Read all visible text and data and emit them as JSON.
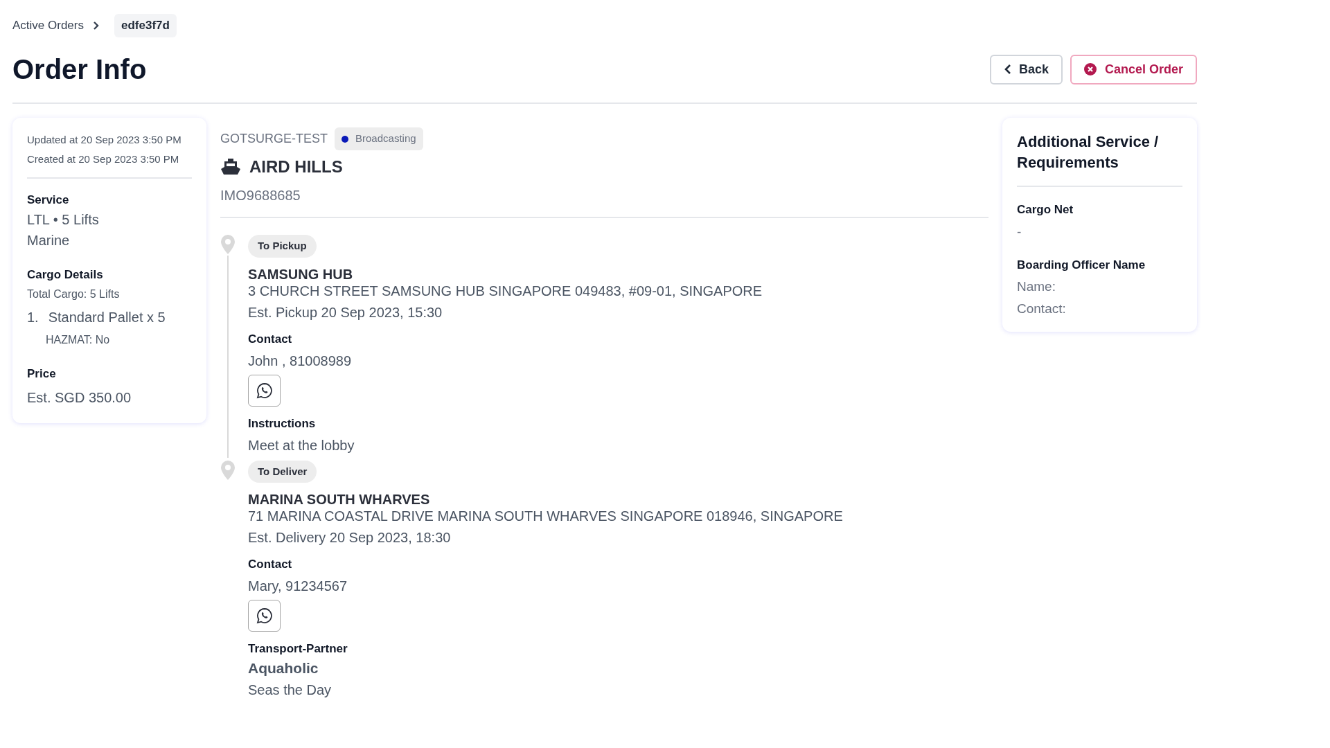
{
  "breadcrumb": {
    "parent": "Active Orders",
    "current": "edfe3f7d"
  },
  "title": "Order Info",
  "actions": {
    "back": "Back",
    "cancel": "Cancel Order"
  },
  "summary": {
    "updated": "Updated at 20 Sep 2023 3:50 PM",
    "created": "Created at 20 Sep 2023 3:50 PM",
    "service": {
      "label": "Service",
      "lines": [
        "LTL • 5 Lifts",
        "Marine"
      ]
    },
    "cargo": {
      "label": "Cargo Details",
      "total": "Total Cargo: 5 Lifts",
      "items": [
        {
          "number": "1.",
          "name": "Standard Pallet x 5",
          "hazmat": "HAZMAT: No"
        }
      ]
    },
    "price": {
      "label": "Price",
      "value": "Est. SGD 350.00"
    }
  },
  "vessel": {
    "company": "GOTSURGE-TEST",
    "status": {
      "label": "Broadcasting",
      "color": "#0a1ab8"
    },
    "name": "AIRD HILLS",
    "imo": "IMO9688685"
  },
  "stops": [
    {
      "tag": "To Pickup",
      "name": "SAMSUNG HUB",
      "address": "3 CHURCH STREET SAMSUNG HUB SINGAPORE 049483, #09-01, SINGAPORE",
      "eta": "Est. Pickup 20 Sep 2023, 15:30",
      "contact_label": "Contact",
      "contact": "John , 81008989",
      "extra": {
        "kind": "text",
        "label": "Instructions",
        "value": "Meet at the lobby"
      }
    },
    {
      "tag": "To Deliver",
      "name": "MARINA SOUTH WHARVES",
      "address": "71 MARINA COASTAL DRIVE MARINA SOUTH WHARVES SINGAPORE 018946, SINGAPORE",
      "eta": "Est. Delivery 20 Sep 2023, 18:30",
      "contact_label": "Contact",
      "contact": "Mary, 91234567",
      "extra": {
        "kind": "partner",
        "label": "Transport-Partner",
        "value": "Aquaholic",
        "subtitle": "Seas the Day"
      }
    }
  ],
  "additional": {
    "title": "Additional Service / Requirements",
    "sections": [
      {
        "label": "Cargo Net",
        "lines": [
          "-"
        ]
      },
      {
        "label": "Boarding Officer Name",
        "lines": [
          "Name:",
          "Contact:"
        ]
      }
    ]
  }
}
